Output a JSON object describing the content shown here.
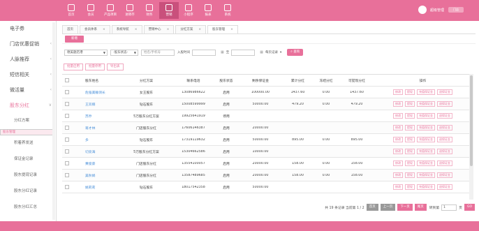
{
  "topnav": [
    {
      "label": "首页",
      "icon": "home-icon"
    },
    {
      "label": "会员",
      "icon": "member-icon"
    },
    {
      "label": "产品项目",
      "icon": "product-icon"
    },
    {
      "label": "进销存",
      "icon": "inventory-icon"
    },
    {
      "label": "财务",
      "icon": "finance-icon"
    },
    {
      "label": "营销",
      "icon": "marketing-icon",
      "active": true
    },
    {
      "label": "小程序",
      "icon": "miniapp-icon"
    },
    {
      "label": "报表",
      "icon": "report-icon"
    },
    {
      "label": "系统",
      "icon": "system-icon"
    }
  ],
  "user": {
    "name": "超级管理",
    "dropdown": "门店"
  },
  "sidebar": {
    "items": [
      {
        "label": "电子券",
        "chev": ""
      },
      {
        "label": "门店优惠促销",
        "chev": "‹"
      },
      {
        "label": "人脉推荐",
        "chev": "‹"
      },
      {
        "label": "短信相关",
        "chev": "‹"
      },
      {
        "label": "微活量",
        "chev": "‹"
      },
      {
        "label": "股东分红",
        "chev": "∨"
      }
    ],
    "subitems": [
      "分红方案",
      "股东管理",
      "积着养发送",
      "保证金记录",
      "股东提现记录",
      "股东分红记录",
      "股东分红汇总"
    ]
  },
  "tabs": [
    "首页",
    "会员体系",
    "系统导航",
    "营销中心",
    "分红方案",
    "股东管理"
  ],
  "subbar_button": "新增",
  "filters": {
    "store": "德美题店港",
    "status": "-股东状态-",
    "name_placeholder": "姓名/手机号",
    "date_label": "入股时间",
    "to_label": "至",
    "page_size": "每页记录",
    "query": "查询"
  },
  "batch_buttons": [
    "批量启用",
    "批量停用",
    "导出表"
  ],
  "table": {
    "headers": [
      "股东姓名",
      "分红方案",
      "联系电话",
      "股东状态",
      "剩余保证金",
      "累计分红",
      "冻结分红",
      "可提现分红",
      "操作"
    ],
    "rows": [
      [
        "危强美静测长",
        "女王股东",
        "13086986622",
        "启用",
        "100000.00",
        "1437.60",
        "0.00",
        "1437.60"
      ],
      [
        "王双楠",
        "钻石股东",
        "15008599999",
        "启用",
        "50000.00",
        "479.20",
        "0.00",
        "479.20"
      ],
      [
        "苏乔",
        "5万股东分红方案",
        "19925641919",
        "停用",
        "",
        "",
        "",
        ""
      ],
      [
        "蒋才林",
        "门店股东分红",
        "17606146387",
        "启用",
        "20000.00",
        "",
        "",
        ""
      ],
      [
        "多",
        "钻石股东",
        "17319119632",
        "启用",
        "50000.00",
        "895.00",
        "0.00",
        "895.00"
      ],
      [
        "切亮海",
        "5万股东分红方案",
        "15304662586",
        "启用",
        "10000.00",
        "",
        "",
        ""
      ],
      [
        "黄俊豪",
        "门店股东分红",
        "13554100057",
        "启用",
        "20000.00",
        "158.00",
        "0.00",
        "158.00"
      ],
      [
        "吴秋娟",
        "门店股东分红",
        "13587489685",
        "启用",
        "20000.00",
        "158.00",
        "0.00",
        "158.00"
      ],
      [
        "姚莉莉",
        "钻石股东",
        "18017542358",
        "启用",
        "50000.00",
        "",
        "",
        ""
      ]
    ],
    "actions": [
      "修改",
      "提现",
      "充值保证金",
      "退保证金"
    ]
  },
  "pager": {
    "summary": "共 19 条记录 当前第 1 / 2",
    "first": "首页",
    "prev": "上一页",
    "next": "下一页",
    "last": "尾页",
    "goto_label": "转到第",
    "goto_value": "1",
    "page_unit": "页",
    "go": "GO"
  },
  "colors": {
    "accent": "#e8709a",
    "link": "#4a90d9"
  }
}
